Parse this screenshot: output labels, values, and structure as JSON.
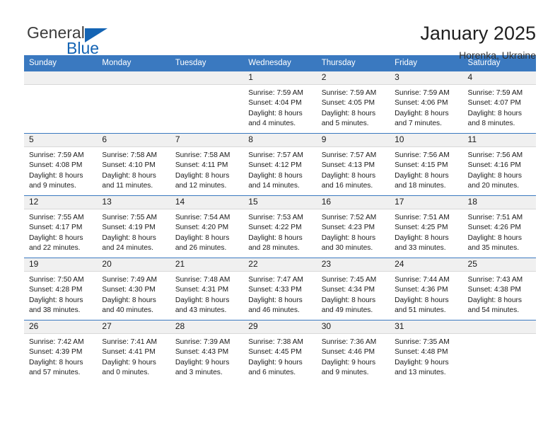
{
  "brand": {
    "name_top": "General",
    "name_bottom": "Blue",
    "triangle_color": "#1464b4",
    "text_color": "#3c3c3c"
  },
  "header": {
    "title": "January 2025",
    "subtitle": "Horenka, Ukraine"
  },
  "theme": {
    "header_blue": "#3a79c0",
    "daynum_band": "#f0f0f0",
    "separator": "#3a79c0"
  },
  "weekday_headers": [
    "Sunday",
    "Monday",
    "Tuesday",
    "Wednesday",
    "Thursday",
    "Friday",
    "Saturday"
  ],
  "weeks": [
    [
      {
        "day": "",
        "sunrise": "",
        "sunset": "",
        "daylight_line1": "",
        "daylight_line2": "",
        "empty": true
      },
      {
        "day": "",
        "sunrise": "",
        "sunset": "",
        "daylight_line1": "",
        "daylight_line2": "",
        "empty": true
      },
      {
        "day": "",
        "sunrise": "",
        "sunset": "",
        "daylight_line1": "",
        "daylight_line2": "",
        "empty": true
      },
      {
        "day": "1",
        "sunrise": "Sunrise: 7:59 AM",
        "sunset": "Sunset: 4:04 PM",
        "daylight_line1": "Daylight: 8 hours",
        "daylight_line2": "and 4 minutes."
      },
      {
        "day": "2",
        "sunrise": "Sunrise: 7:59 AM",
        "sunset": "Sunset: 4:05 PM",
        "daylight_line1": "Daylight: 8 hours",
        "daylight_line2": "and 5 minutes."
      },
      {
        "day": "3",
        "sunrise": "Sunrise: 7:59 AM",
        "sunset": "Sunset: 4:06 PM",
        "daylight_line1": "Daylight: 8 hours",
        "daylight_line2": "and 7 minutes."
      },
      {
        "day": "4",
        "sunrise": "Sunrise: 7:59 AM",
        "sunset": "Sunset: 4:07 PM",
        "daylight_line1": "Daylight: 8 hours",
        "daylight_line2": "and 8 minutes."
      }
    ],
    [
      {
        "day": "5",
        "sunrise": "Sunrise: 7:59 AM",
        "sunset": "Sunset: 4:08 PM",
        "daylight_line1": "Daylight: 8 hours",
        "daylight_line2": "and 9 minutes."
      },
      {
        "day": "6",
        "sunrise": "Sunrise: 7:58 AM",
        "sunset": "Sunset: 4:10 PM",
        "daylight_line1": "Daylight: 8 hours",
        "daylight_line2": "and 11 minutes."
      },
      {
        "day": "7",
        "sunrise": "Sunrise: 7:58 AM",
        "sunset": "Sunset: 4:11 PM",
        "daylight_line1": "Daylight: 8 hours",
        "daylight_line2": "and 12 minutes."
      },
      {
        "day": "8",
        "sunrise": "Sunrise: 7:57 AM",
        "sunset": "Sunset: 4:12 PM",
        "daylight_line1": "Daylight: 8 hours",
        "daylight_line2": "and 14 minutes."
      },
      {
        "day": "9",
        "sunrise": "Sunrise: 7:57 AM",
        "sunset": "Sunset: 4:13 PM",
        "daylight_line1": "Daylight: 8 hours",
        "daylight_line2": "and 16 minutes."
      },
      {
        "day": "10",
        "sunrise": "Sunrise: 7:56 AM",
        "sunset": "Sunset: 4:15 PM",
        "daylight_line1": "Daylight: 8 hours",
        "daylight_line2": "and 18 minutes."
      },
      {
        "day": "11",
        "sunrise": "Sunrise: 7:56 AM",
        "sunset": "Sunset: 4:16 PM",
        "daylight_line1": "Daylight: 8 hours",
        "daylight_line2": "and 20 minutes."
      }
    ],
    [
      {
        "day": "12",
        "sunrise": "Sunrise: 7:55 AM",
        "sunset": "Sunset: 4:17 PM",
        "daylight_line1": "Daylight: 8 hours",
        "daylight_line2": "and 22 minutes."
      },
      {
        "day": "13",
        "sunrise": "Sunrise: 7:55 AM",
        "sunset": "Sunset: 4:19 PM",
        "daylight_line1": "Daylight: 8 hours",
        "daylight_line2": "and 24 minutes."
      },
      {
        "day": "14",
        "sunrise": "Sunrise: 7:54 AM",
        "sunset": "Sunset: 4:20 PM",
        "daylight_line1": "Daylight: 8 hours",
        "daylight_line2": "and 26 minutes."
      },
      {
        "day": "15",
        "sunrise": "Sunrise: 7:53 AM",
        "sunset": "Sunset: 4:22 PM",
        "daylight_line1": "Daylight: 8 hours",
        "daylight_line2": "and 28 minutes."
      },
      {
        "day": "16",
        "sunrise": "Sunrise: 7:52 AM",
        "sunset": "Sunset: 4:23 PM",
        "daylight_line1": "Daylight: 8 hours",
        "daylight_line2": "and 30 minutes."
      },
      {
        "day": "17",
        "sunrise": "Sunrise: 7:51 AM",
        "sunset": "Sunset: 4:25 PM",
        "daylight_line1": "Daylight: 8 hours",
        "daylight_line2": "and 33 minutes."
      },
      {
        "day": "18",
        "sunrise": "Sunrise: 7:51 AM",
        "sunset": "Sunset: 4:26 PM",
        "daylight_line1": "Daylight: 8 hours",
        "daylight_line2": "and 35 minutes."
      }
    ],
    [
      {
        "day": "19",
        "sunrise": "Sunrise: 7:50 AM",
        "sunset": "Sunset: 4:28 PM",
        "daylight_line1": "Daylight: 8 hours",
        "daylight_line2": "and 38 minutes."
      },
      {
        "day": "20",
        "sunrise": "Sunrise: 7:49 AM",
        "sunset": "Sunset: 4:30 PM",
        "daylight_line1": "Daylight: 8 hours",
        "daylight_line2": "and 40 minutes."
      },
      {
        "day": "21",
        "sunrise": "Sunrise: 7:48 AM",
        "sunset": "Sunset: 4:31 PM",
        "daylight_line1": "Daylight: 8 hours",
        "daylight_line2": "and 43 minutes."
      },
      {
        "day": "22",
        "sunrise": "Sunrise: 7:47 AM",
        "sunset": "Sunset: 4:33 PM",
        "daylight_line1": "Daylight: 8 hours",
        "daylight_line2": "and 46 minutes."
      },
      {
        "day": "23",
        "sunrise": "Sunrise: 7:45 AM",
        "sunset": "Sunset: 4:34 PM",
        "daylight_line1": "Daylight: 8 hours",
        "daylight_line2": "and 49 minutes."
      },
      {
        "day": "24",
        "sunrise": "Sunrise: 7:44 AM",
        "sunset": "Sunset: 4:36 PM",
        "daylight_line1": "Daylight: 8 hours",
        "daylight_line2": "and 51 minutes."
      },
      {
        "day": "25",
        "sunrise": "Sunrise: 7:43 AM",
        "sunset": "Sunset: 4:38 PM",
        "daylight_line1": "Daylight: 8 hours",
        "daylight_line2": "and 54 minutes."
      }
    ],
    [
      {
        "day": "26",
        "sunrise": "Sunrise: 7:42 AM",
        "sunset": "Sunset: 4:39 PM",
        "daylight_line1": "Daylight: 8 hours",
        "daylight_line2": "and 57 minutes."
      },
      {
        "day": "27",
        "sunrise": "Sunrise: 7:41 AM",
        "sunset": "Sunset: 4:41 PM",
        "daylight_line1": "Daylight: 9 hours",
        "daylight_line2": "and 0 minutes."
      },
      {
        "day": "28",
        "sunrise": "Sunrise: 7:39 AM",
        "sunset": "Sunset: 4:43 PM",
        "daylight_line1": "Daylight: 9 hours",
        "daylight_line2": "and 3 minutes."
      },
      {
        "day": "29",
        "sunrise": "Sunrise: 7:38 AM",
        "sunset": "Sunset: 4:45 PM",
        "daylight_line1": "Daylight: 9 hours",
        "daylight_line2": "and 6 minutes."
      },
      {
        "day": "30",
        "sunrise": "Sunrise: 7:36 AM",
        "sunset": "Sunset: 4:46 PM",
        "daylight_line1": "Daylight: 9 hours",
        "daylight_line2": "and 9 minutes."
      },
      {
        "day": "31",
        "sunrise": "Sunrise: 7:35 AM",
        "sunset": "Sunset: 4:48 PM",
        "daylight_line1": "Daylight: 9 hours",
        "daylight_line2": "and 13 minutes."
      },
      {
        "day": "",
        "sunrise": "",
        "sunset": "",
        "daylight_line1": "",
        "daylight_line2": "",
        "empty": true
      }
    ]
  ]
}
